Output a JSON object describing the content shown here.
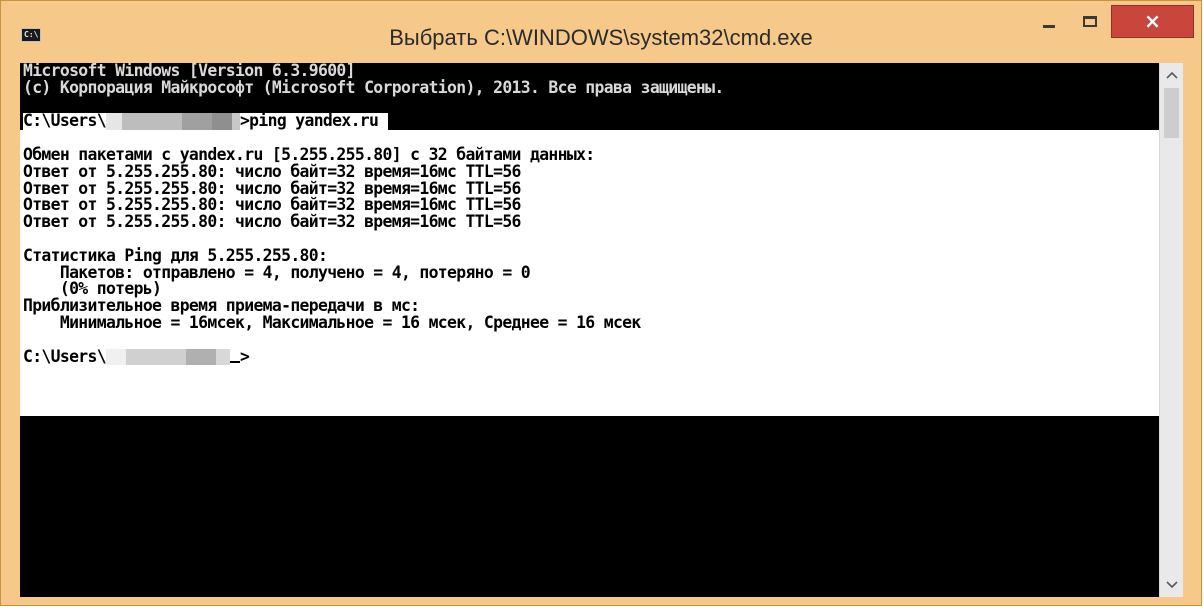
{
  "window": {
    "title": "Выбрать C:\\WINDOWS\\system32\\cmd.exe",
    "icon_label": "C:\\",
    "icon": "cmd-console-icon",
    "controls": {
      "minimize": "minimize-icon",
      "maximize": "maximize-icon",
      "close": "×"
    }
  },
  "colors": {
    "frame": "#f6c98a",
    "close_button": "#c9463d",
    "console_bg": "#000000",
    "console_text": "#d9d9d9",
    "selection_bg": "#ffffff",
    "selection_text": "#000000"
  },
  "console": {
    "header": [
      "Microsoft Windows [Version 6.3.9600]",
      "(c) Корпорация Майкрософт (Microsoft Corporation), 2013. Все права защищены."
    ],
    "prompt_prefix": "C:\\Users\\",
    "command_suffix": ">ping yandex.ru",
    "output": [
      "Обмен пакетами с yandex.ru [5.255.255.80] с 32 байтами данных:",
      "Ответ от 5.255.255.80: число байт=32 время=16мс TTL=56",
      "Ответ от 5.255.255.80: число байт=32 время=16мс TTL=56",
      "Ответ от 5.255.255.80: число байт=32 время=16мс TTL=56",
      "Ответ от 5.255.255.80: число байт=32 время=16мс TTL=56",
      "",
      "Статистика Ping для 5.255.255.80:",
      "    Пакетов: отправлено = 4, получено = 4, потеряно = 0",
      "    (0% потерь)",
      "Приблизительное время приема-передачи в мс:",
      "    Минимальное = 16мсек, Максимальное = 16 мсек, Среднее = 16 мсек"
    ],
    "final_prompt_suffix": ">"
  },
  "scrollbar": {
    "up": "^",
    "down": "v"
  }
}
